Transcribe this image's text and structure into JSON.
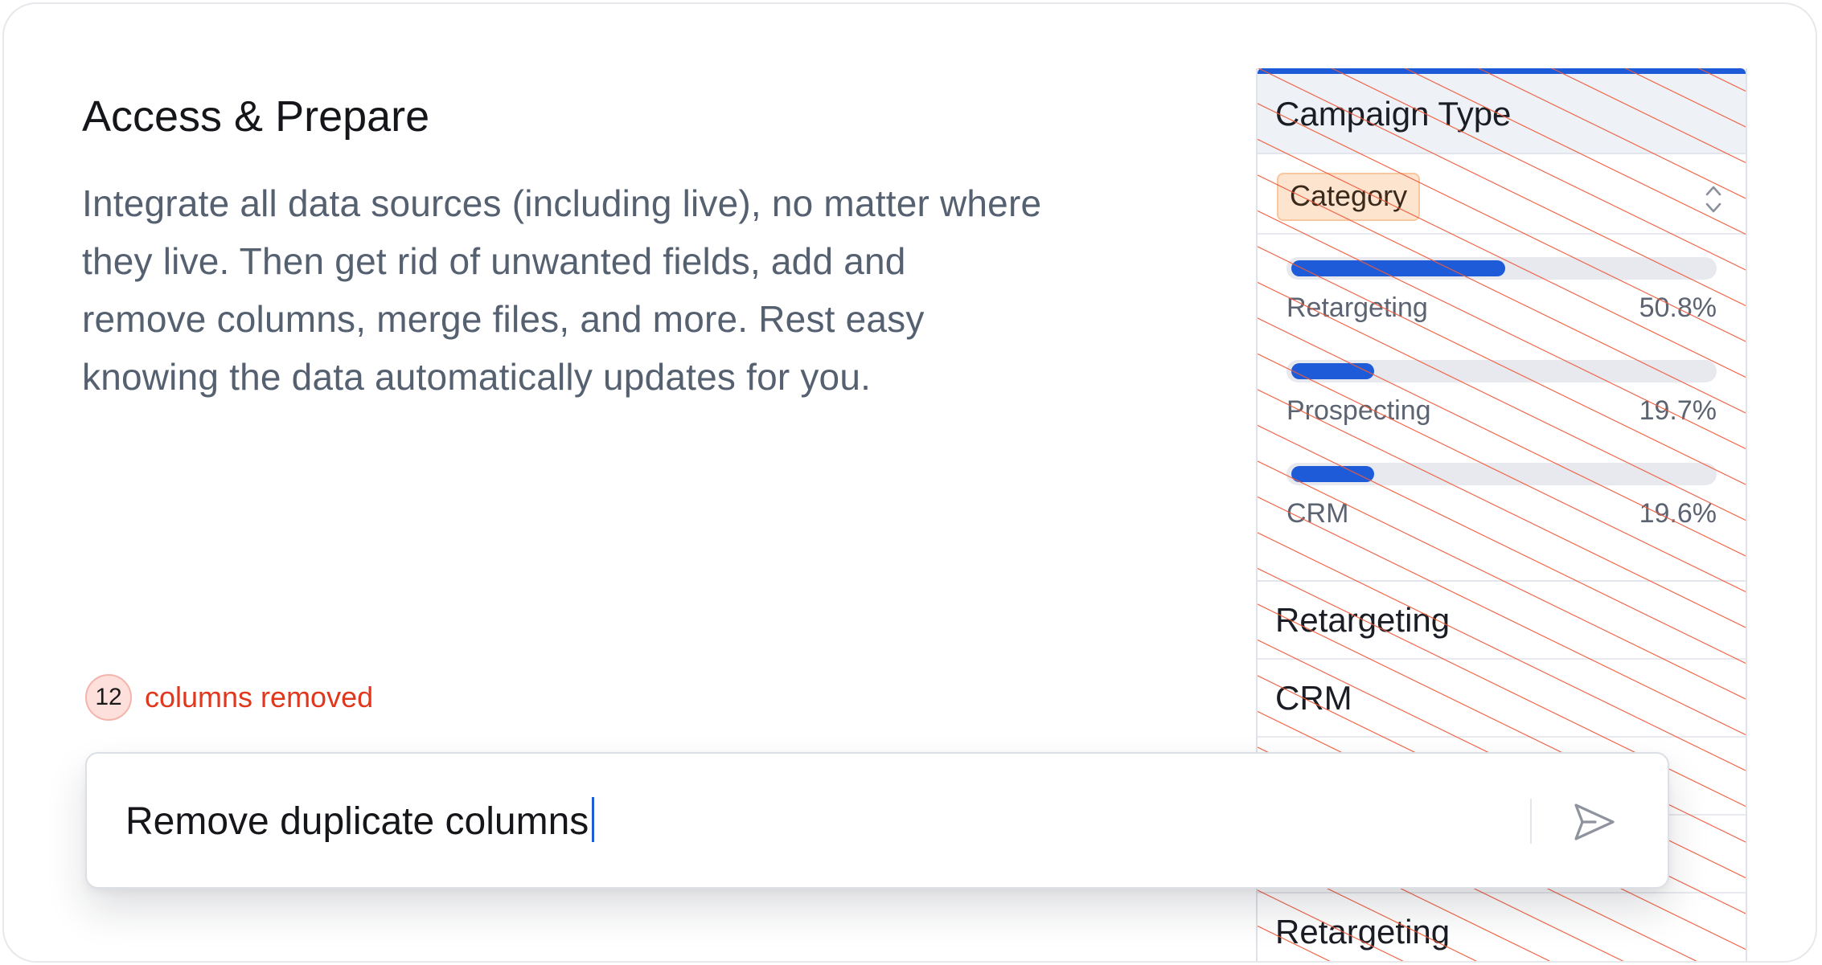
{
  "section": {
    "title": "Access & Prepare",
    "description_lines": [
      "Integrate all data sources (including live), no matter where",
      "they live. Then get rid of unwanted fields, add and",
      "remove columns, merge files, and more. Rest easy",
      "knowing the data automatically updates for you."
    ]
  },
  "column": {
    "header": "Campaign Type",
    "type_badge": "Category",
    "sort_icon": "sort-updown-icon",
    "accent_color": "#1d5bd8",
    "hatch_color": "#ef5a3c",
    "stats": [
      {
        "label": "Retargeting",
        "value": "50.8%",
        "fraction": 0.508
      },
      {
        "label": "Prospecting",
        "value": "19.7%",
        "fraction": 0.197
      },
      {
        "label": "CRM",
        "value": "19.6%",
        "fraction": 0.196
      }
    ],
    "cells": [
      "Retargeting",
      "CRM",
      "",
      "",
      "Retargeting"
    ]
  },
  "removed": {
    "count": "12",
    "label": "columns removed",
    "color": "#e0371d"
  },
  "prompt": {
    "value": "Remove duplicate columns",
    "send_icon": "send-icon"
  }
}
